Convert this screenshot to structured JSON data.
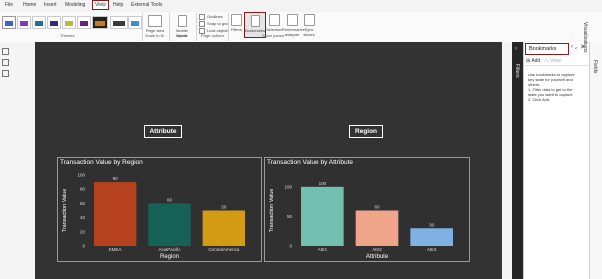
{
  "ribbon": {
    "file_tab": "File",
    "tabs": [
      "Home",
      "Insert",
      "Modeling",
      "View",
      "Help",
      "External Tools"
    ],
    "active_tab": "View",
    "groups": [
      "Themes",
      "Scale to fit",
      "Mobile",
      "Page options",
      "Show panes"
    ],
    "page_view_label": "Page view",
    "mobile_layout_label": "Mobile layout",
    "page_options": [
      "Gridlines",
      "Snap to grid",
      "Lock objects"
    ],
    "show_panes": [
      "Filters",
      "Bookmarks",
      "Selection",
      "Performance analyzer",
      "Sync slicers"
    ],
    "highlighted_pane": "Bookmarks",
    "theme_colors": [
      "#3e64c8",
      "#7a3cb8",
      "#1f6f9a",
      "#2a2a80",
      "#b8b83a",
      "#6a2080"
    ]
  },
  "report": {
    "header_left": "Attribute",
    "header_right": "Region"
  },
  "filters_label": "Filters",
  "bookmarks": {
    "title": "Bookmarks",
    "add_label": "Add",
    "view_label": "View",
    "help_text": "Use bookmarks to capture key state for yourself and others.",
    "step1": "1. Filter data to get to the state you want to capture",
    "step2": "2. Click Add."
  },
  "side_labels": {
    "visualizations": "Visualizations",
    "fields": "Fields"
  },
  "chart_data": [
    {
      "type": "bar",
      "title": "Transaction Value by Region",
      "xlabel": "Region",
      "ylabel": "Transaction Value",
      "categories": [
        "EMEA",
        "AsiaPacific",
        "CentralAmerica"
      ],
      "values": [
        90,
        60,
        50
      ],
      "colors": [
        "#b5411e",
        "#176257",
        "#d39a14"
      ],
      "ylim": [
        0,
        100
      ],
      "yticks": [
        0,
        20,
        40,
        60,
        80,
        100
      ]
    },
    {
      "type": "bar",
      "title": "Transaction Value by Attribute",
      "xlabel": "Attribute",
      "ylabel": "Transaction Value",
      "categories": [
        "Attr1",
        "Attr2",
        "Attr3"
      ],
      "values": [
        100,
        60,
        30
      ],
      "colors": [
        "#73bfb0",
        "#f0a58a",
        "#7fb1e3"
      ],
      "ylim": [
        0,
        120
      ],
      "yticks": [
        0,
        50,
        100
      ]
    }
  ]
}
